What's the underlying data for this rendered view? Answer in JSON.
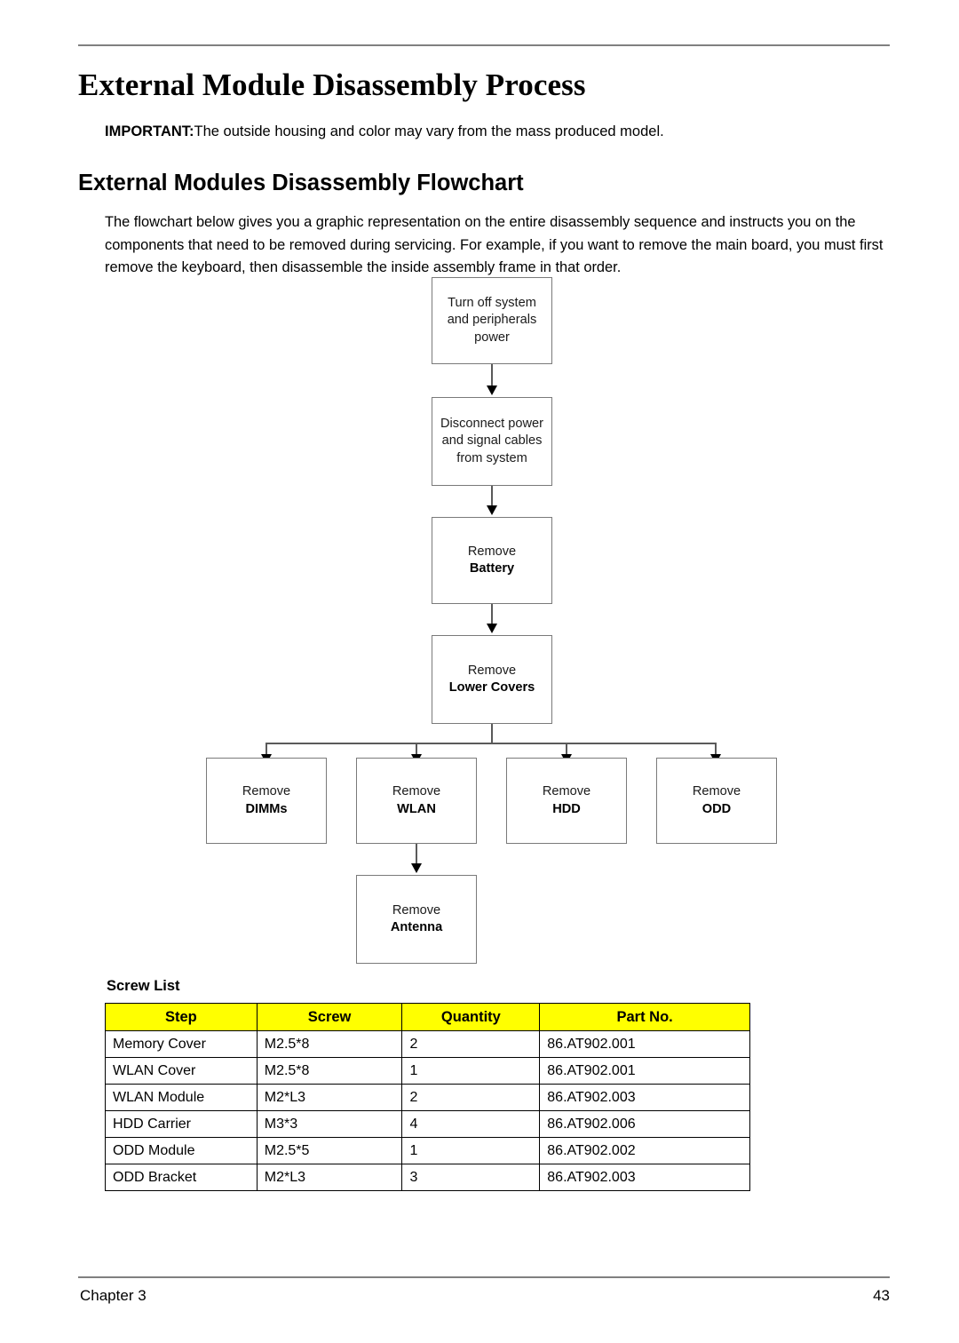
{
  "document": {
    "title": "External Module Disassembly Process",
    "important": {
      "keyword": "IMPORTANT:",
      "text": "The outside housing and color may vary from the mass produced model."
    },
    "section_heading": "External Modules Disassembly Flowchart",
    "intro_paragraph": "The flowchart below gives you a graphic representation on the entire disassembly sequence and instructs you on the components that need to be removed during servicing. For example, if you want to remove the main board, you must first remove the keyboard, then disassemble the inside assembly frame in that order."
  },
  "flowchart": {
    "nodes": [
      {
        "id": "power",
        "line1": "Turn off system",
        "line2": "and peripherals",
        "line3": "power",
        "bold_line": ""
      },
      {
        "id": "cables",
        "line1": "Disconnect power",
        "line2": "and signal cables",
        "line3": "from system",
        "bold_line": ""
      },
      {
        "id": "battery",
        "line1": "Remove",
        "bold_line": "Battery"
      },
      {
        "id": "lower-covers",
        "line1": "Remove",
        "bold_line": "Lower Covers"
      },
      {
        "id": "dimms",
        "line1": "Remove",
        "bold_line": "DIMMs"
      },
      {
        "id": "wlan",
        "line1": "Remove",
        "bold_line": "WLAN"
      },
      {
        "id": "hdd",
        "line1": "Remove",
        "bold_line": "HDD"
      },
      {
        "id": "odd",
        "line1": "Remove",
        "bold_line": "ODD"
      },
      {
        "id": "antenna",
        "line1": "Remove",
        "bold_line": "Antenna"
      }
    ]
  },
  "screw_list": {
    "label": "Screw List",
    "header_color": "#FFFF00",
    "columns": [
      "Step",
      "Screw",
      "Quantity",
      "Part No."
    ],
    "rows": [
      {
        "step": "Memory Cover",
        "screw": "M2.5*8",
        "quantity": "2",
        "part_no": "86.AT902.001"
      },
      {
        "step": "WLAN Cover",
        "screw": "M2.5*8",
        "quantity": "1",
        "part_no": "86.AT902.001"
      },
      {
        "step": "WLAN Module",
        "screw": "M2*L3",
        "quantity": "2",
        "part_no": "86.AT902.003"
      },
      {
        "step": "HDD Carrier",
        "screw": "M3*3",
        "quantity": "4",
        "part_no": "86.AT902.006"
      },
      {
        "step": "ODD Module",
        "screw": "M2.5*5",
        "quantity": "1",
        "part_no": "86.AT902.002"
      },
      {
        "step": "ODD Bracket",
        "screw": "M2*L3",
        "quantity": "3",
        "part_no": "86.AT902.003"
      }
    ]
  },
  "footer": {
    "chapter": "Chapter 3",
    "page_number": "43"
  }
}
